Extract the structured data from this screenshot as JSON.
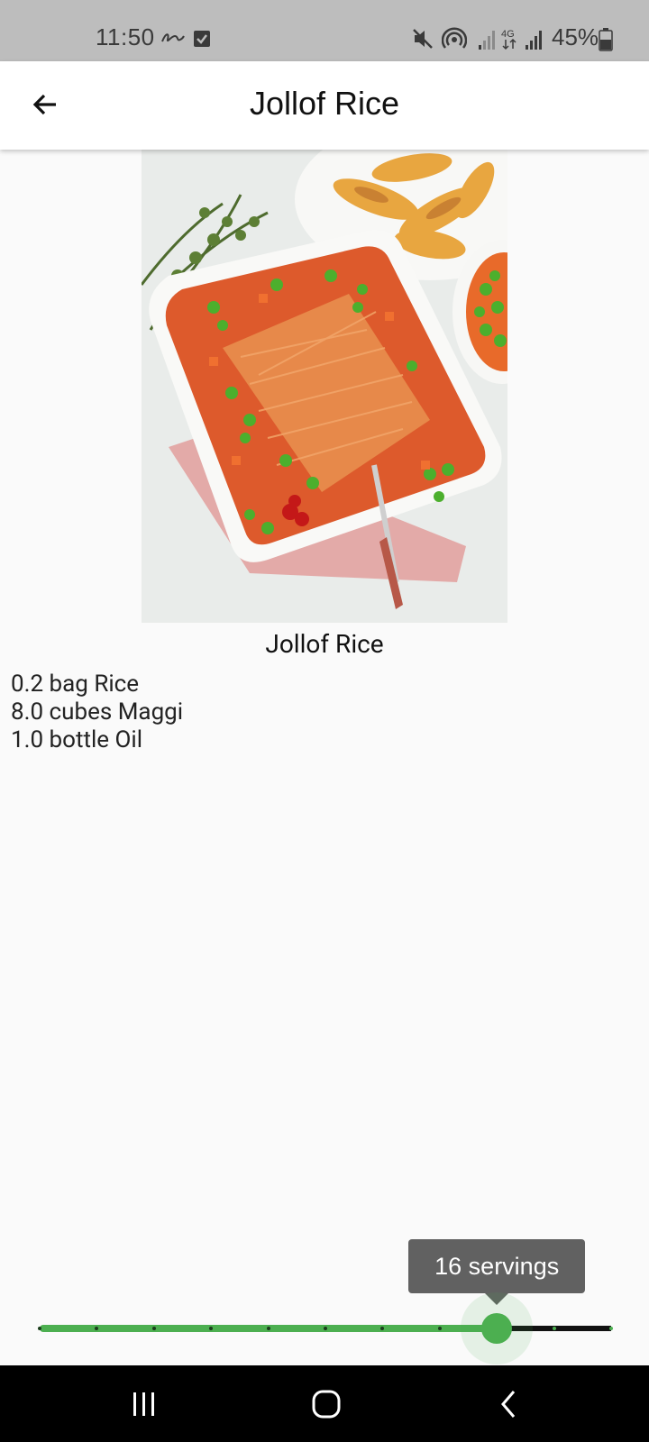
{
  "status_bar": {
    "time": "11:50",
    "battery": "45%"
  },
  "app_bar": {
    "title": "Jollof Rice"
  },
  "recipe": {
    "name": "Jollof Rice",
    "ingredients": [
      "0.2 bag Rice",
      "8.0 cubes Maggi",
      "1.0 bottle Oil"
    ]
  },
  "slider": {
    "tooltip": "16 servings",
    "value_fraction": 0.8,
    "divisions": 10,
    "active_color": "#4caf50",
    "inactive_color": "#111111"
  },
  "icons": {
    "back": "arrow-back-icon",
    "nav_recents": "recents-icon",
    "nav_home": "home-icon",
    "nav_back": "nav-back-icon"
  },
  "colors": {
    "status_bar": "#bdbdbd",
    "app_bar": "#ffffff",
    "background": "#fafafa",
    "tooltip": "#616161",
    "nav_bar": "#000000"
  }
}
